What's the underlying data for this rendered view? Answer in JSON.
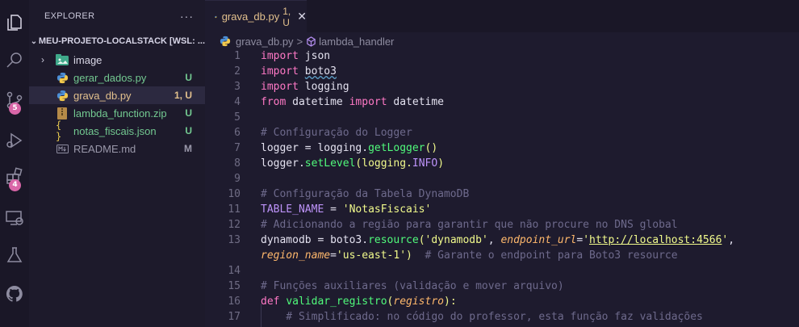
{
  "explorer": {
    "title": "EXPLORER",
    "more": "···",
    "root": "MEU-PROJETO-LOCALSTACK [WSL: ...",
    "files": [
      {
        "name": "image",
        "status": "",
        "icon": "image-folder-icon"
      },
      {
        "name": "gerar_dados.py",
        "status": "U",
        "icon": "python-icon"
      },
      {
        "name": "grava_db.py",
        "status": "1, U",
        "icon": "python-icon"
      },
      {
        "name": "lambda_function.zip",
        "status": "U",
        "icon": "zip-icon"
      },
      {
        "name": "notas_fiscais.json",
        "status": "U",
        "icon": "json-icon"
      },
      {
        "name": "README.md",
        "status": "M",
        "icon": "markdown-icon"
      }
    ]
  },
  "activity": {
    "scm_badge": "5",
    "extensions_badge": "4"
  },
  "tab": {
    "name": "grava_db.py",
    "status": "1, U",
    "close": "✕"
  },
  "breadcrumb": {
    "file": "grava_db.py",
    "sep": ">",
    "symbol": "lambda_handler"
  },
  "code": {
    "numbers": [
      "1",
      "2",
      "3",
      "4",
      "5",
      "6",
      "7",
      "8",
      "9",
      "10",
      "11",
      "12",
      "13",
      "",
      "14",
      "15",
      "16",
      "17"
    ],
    "l1": {
      "kw": "import",
      "rest": " json"
    },
    "l2": {
      "kw": "import",
      "sp": " ",
      "mod": "boto3"
    },
    "l3": {
      "kw": "import",
      "rest": " logging"
    },
    "l4": {
      "kw1": "from",
      "mid": " datetime ",
      "kw2": "import",
      "rest": " datetime"
    },
    "l6": "# Configuração do Logger",
    "l7": {
      "a": "logger = logging.",
      "fn": "getLogger",
      "b": "()"
    },
    "l8": {
      "a": "logger.",
      "fn": "setLevel",
      "b": "(logging.",
      "cst": "INFO",
      "c": ")"
    },
    "l10": "# Configuração da Tabela DynamoDB",
    "l11": {
      "cst": "TABLE_NAME",
      "a": " = ",
      "str": "'NotasFiscais'"
    },
    "l12": "# Adicionando a região para garantir que não procure no DNS global",
    "l13": {
      "a": "dynamodb = boto3.",
      "fn": "resource",
      "b": "(",
      "s1": "'dynamodb'",
      "c": ", ",
      "p1": "endpoint_url",
      "d": "=",
      "q1": "'",
      "url": "http://localhost:4566",
      "q2": "'",
      "e": ","
    },
    "l13b": {
      "p2": "region_name",
      "a": "=",
      "s2": "'us-east-1'",
      "b": ")  ",
      "cm": "# Garante o endpoint para Boto3 resource"
    },
    "l15": "# Funções auxiliares (validação e mover arquivo)",
    "l16": {
      "kw": "def",
      "sp": " ",
      "fn": "validar_registro",
      "a": "(",
      "prm": "registro",
      "b": "):"
    },
    "l17": "    # Simplificado: no código do professor, esta função faz validações"
  }
}
